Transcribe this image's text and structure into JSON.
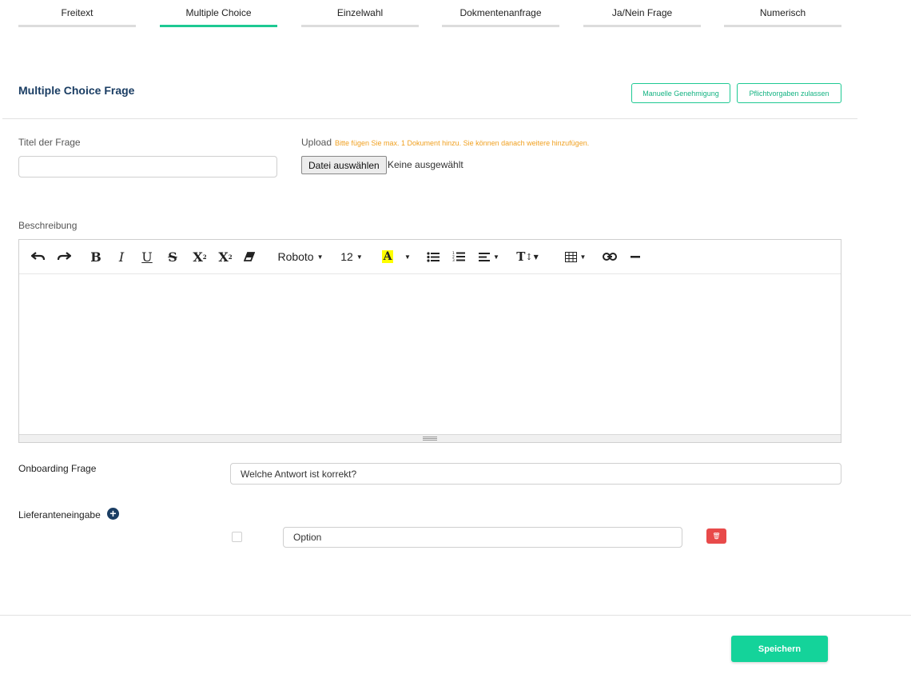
{
  "tabs": [
    {
      "label": "Freitext",
      "active": false
    },
    {
      "label": "Multiple Choice",
      "active": true
    },
    {
      "label": "Einzelwahl",
      "active": false
    },
    {
      "label": "Dokmentenanfrage",
      "active": false
    },
    {
      "label": "Ja/Nein Frage",
      "active": false
    },
    {
      "label": "Numerisch",
      "active": false
    }
  ],
  "header": {
    "title": "Multiple Choice Frage",
    "manual_approval_label": "Manuelle Genehmigung",
    "allow_requirements_label": "Pflichtvorgaben zulassen"
  },
  "form": {
    "title_label": "Titel der Frage",
    "title_value": "",
    "upload_label": "Upload",
    "upload_hint": "Bitte fügen Sie max. 1 Dokument hinzu. Sie können danach weitere hinzufügen.",
    "file_button_label": "Datei auswählen",
    "file_status": "Keine ausgewählt",
    "description_label": "Beschreibung",
    "onboarding_label": "Onboarding Frage",
    "onboarding_value": "Welche Antwort ist korrekt?",
    "supplier_input_label": "Lieferanteneingabe",
    "add_icon": "+",
    "option_value": "Option",
    "option_checked": false,
    "delete_icon": "🗑"
  },
  "editor_toolbar": {
    "font_family": "Roboto",
    "font_size": "12",
    "highlight_color": "#ffff00",
    "tools": [
      "undo-icon",
      "redo-icon",
      "bold-icon",
      "italic-icon",
      "underline-icon",
      "strikethrough-icon",
      "superscript-icon",
      "subscript-icon",
      "eraser-icon",
      "font-family-select",
      "font-size-select",
      "highlight-icon",
      "bulleted-list-icon",
      "numbered-list-icon",
      "align-icon",
      "text-height-icon",
      "table-icon",
      "link-icon",
      "horizontal-rule-icon"
    ]
  },
  "footer": {
    "save_label": "Speichern"
  },
  "colors": {
    "accent": "#1ec993",
    "title": "#1a3d63",
    "danger": "#e84a4a",
    "hint": "#f0a020"
  }
}
